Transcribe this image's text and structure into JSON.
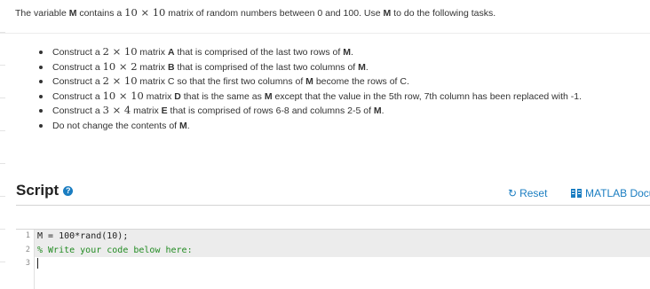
{
  "problem": {
    "intro": {
      "pre": "The variable ",
      "var": "M",
      "mid": " contains a ",
      "dims": "10 × 10",
      "post": " matrix of random numbers between 0 and 100. Use ",
      "var2": "M",
      "end": " to do the following tasks."
    },
    "tasks": [
      {
        "t1": "Construct a ",
        "d": "2 × 10",
        "t2": " matrix ",
        "v1": "A",
        "t3": " that is comprised of the last two rows of ",
        "v2": "M",
        "t4": "."
      },
      {
        "t1": "Construct a ",
        "d": "10 × 2",
        "t2": " matrix ",
        "v1": "B",
        "t3": " that is comprised of the last two columns of ",
        "v2": "M",
        "t4": "."
      },
      {
        "t1": "Construct a ",
        "d": "2 × 10",
        "t2": " matrix C so that the first two columns of ",
        "v1": "M",
        "t3": " become the rows of C.",
        "v2": "",
        "t4": ""
      },
      {
        "t1": "Construct a ",
        "d": "10 × 10",
        "t2": " matrix ",
        "v1": "D",
        "t3": " that is the same as ",
        "v2": "M",
        "t4": " except that the value in the 5th row, 7th column has been replaced with -1."
      },
      {
        "t1": "Construct a ",
        "d": "3 × 4",
        "t2": " matrix ",
        "v1": "E",
        "t3": " that is comprised of rows 6-8 and columns 2-5 of ",
        "v2": "M",
        "t4": "."
      },
      {
        "t1": "Do not change the contents of ",
        "d": "",
        "t2": "",
        "v1": "M",
        "t3": ".",
        "v2": "",
        "t4": ""
      }
    ]
  },
  "script": {
    "title": "Script",
    "help_icon": "question-circle-icon",
    "reset_label": "Reset",
    "reset_icon": "refresh-icon",
    "doc_label": "MATLAB Docu",
    "doc_icon": "book-grid-icon",
    "lines": [
      {
        "num": "1",
        "text": "M = 100*rand(10);",
        "kind": "normal"
      },
      {
        "num": "2",
        "text": "% Write your code below here:",
        "kind": "comment"
      },
      {
        "num": "3",
        "text": "",
        "kind": "normal"
      }
    ]
  },
  "colors": {
    "link": "#1a7dc1",
    "comment": "#228b22",
    "code_bg": "#ececec"
  }
}
